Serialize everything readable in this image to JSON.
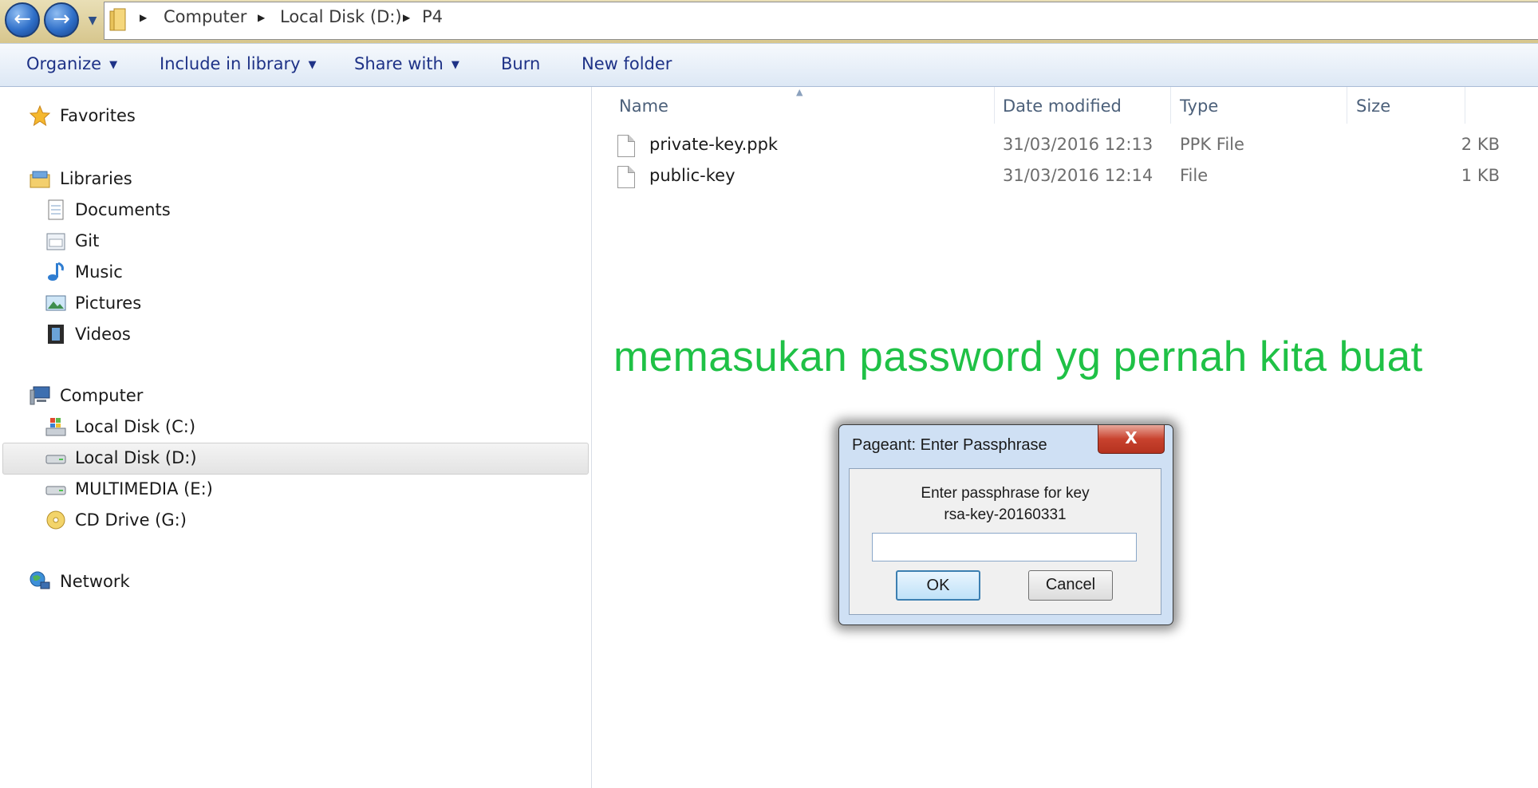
{
  "address_bar": {
    "breadcrumbs": [
      "Computer",
      "Local Disk (D:)",
      "P4"
    ]
  },
  "toolbar": {
    "organize": "Organize",
    "include_in_library": "Include in library",
    "share_with": "Share with",
    "burn": "Burn",
    "new_folder": "New folder"
  },
  "navigation": {
    "favorites": "Favorites",
    "libraries": "Libraries",
    "library_items": [
      "Documents",
      "Git",
      "Music",
      "Pictures",
      "Videos"
    ],
    "computer": "Computer",
    "drives": [
      "Local Disk (C:)",
      "Local Disk (D:)",
      "MULTIMEDIA (E:)",
      "CD Drive (G:)"
    ],
    "selected_drive": "Local Disk (D:)",
    "network": "Network"
  },
  "file_list": {
    "columns": [
      "Name",
      "Date modified",
      "Type",
      "Size"
    ],
    "rows": [
      {
        "name": "private-key.ppk",
        "date": "31/03/2016 12:13",
        "type": "PPK File",
        "size": "2 KB"
      },
      {
        "name": "public-key",
        "date": "31/03/2016 12:14",
        "type": "File",
        "size": "1 KB"
      }
    ]
  },
  "caption": "memasukan password yg pernah kita buat",
  "dialog": {
    "title": "Pageant: Enter Passphrase",
    "close": "X",
    "prompt_line1": "Enter passphrase for key",
    "prompt_line2": "rsa-key-20160331",
    "input_value": "",
    "ok": "OK",
    "cancel": "Cancel"
  },
  "colors": {
    "caption": "#1fc146",
    "toolbar_text": "#1e3287",
    "close_button": "#c8422e"
  }
}
